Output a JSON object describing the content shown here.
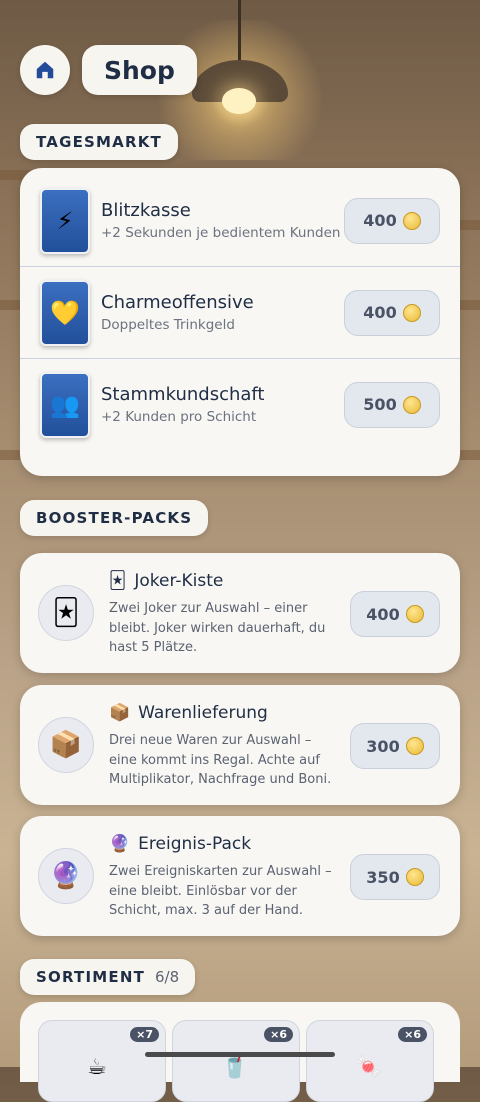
{
  "header": {
    "title": "Shop",
    "home_icon": "home-icon"
  },
  "tagesmarkt": {
    "label": "TAGESMARKT",
    "items": [
      {
        "icon": "⚡",
        "name": "Blitzkasse",
        "desc": "+2 Sekunden je bedientem Kunden",
        "price": "400"
      },
      {
        "icon": "💛",
        "name": "Charmeoffensive",
        "desc": "Doppeltes Trinkgeld",
        "price": "400"
      },
      {
        "icon": "👥",
        "name": "Stammkundschaft",
        "desc": "+2 Kunden pro Schicht",
        "price": "500"
      }
    ]
  },
  "boosters": {
    "label": "BOOSTER-PACKS",
    "items": [
      {
        "icon": "🃏",
        "name": "Joker-Kiste",
        "desc": "Zwei Joker zur Auswahl – einer bleibt. Joker wirken dauerhaft, du hast 5 Plätze.",
        "price": "400"
      },
      {
        "icon": "📦",
        "name": "Warenlieferung",
        "desc": "Drei neue Waren zur Auswahl – eine kommt ins Regal. Achte auf Multiplikator, Nachfrage und Boni.",
        "price": "300"
      },
      {
        "icon": "🔮",
        "name": "Ereignis-Pack",
        "desc": "Zwei Ereigniskarten zur Auswahl – eine bleibt. Einlösbar vor der Schicht, max. 3 auf der Hand.",
        "price": "350"
      }
    ]
  },
  "sortiment": {
    "label": "SORTIMENT",
    "count": "6/8",
    "items": [
      {
        "emoji": "☕",
        "qty": "×7"
      },
      {
        "emoji": "🥤",
        "qty": "×6"
      },
      {
        "emoji": "🍬",
        "qty": "×6"
      }
    ]
  }
}
